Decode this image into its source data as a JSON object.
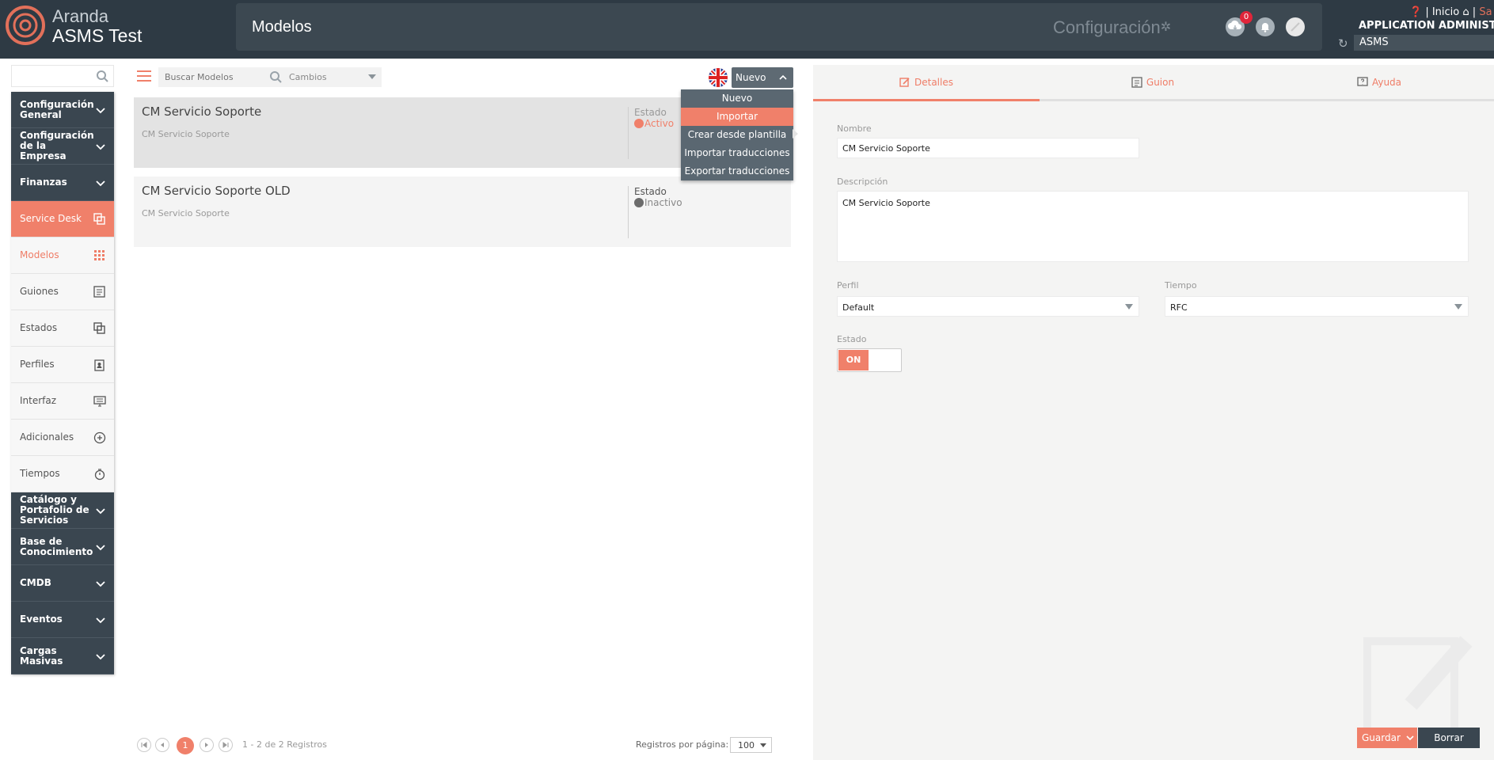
{
  "app": {
    "brand_line1": "Aranda",
    "brand_line2": "ASMS Test"
  },
  "header": {
    "page_title": "Modelos",
    "config_label": "Configuración",
    "notification_count": "0",
    "home_label": "Inicio",
    "exit_label": "Sa",
    "user_name": "APPLICATION ADMINISTRATO",
    "project": "ASMS"
  },
  "sidebar": {
    "search_placeholder": "",
    "items": [
      {
        "label": "Configuración General",
        "style": "dark",
        "icon": "chevron-down-icon"
      },
      {
        "label": "Configuración de la Empresa",
        "style": "dark",
        "icon": "chevron-down-icon"
      },
      {
        "label": "Finanzas",
        "style": "dark",
        "icon": "chevron-down-icon"
      },
      {
        "label": "Service Desk",
        "style": "orange",
        "icon": "copy-icon"
      },
      {
        "label": "Modelos",
        "style": "active",
        "icon": "grid-icon"
      },
      {
        "label": "Guiones",
        "style": "light",
        "icon": "document-icon"
      },
      {
        "label": "Estados",
        "style": "light",
        "icon": "copy-icon"
      },
      {
        "label": "Perfiles",
        "style": "light",
        "icon": "clipboard-user-icon"
      },
      {
        "label": "Interfaz",
        "style": "light",
        "icon": "monitor-icon"
      },
      {
        "label": "Adicionales",
        "style": "light",
        "icon": "plus-circle-icon"
      },
      {
        "label": "Tiempos",
        "style": "light",
        "icon": "stopwatch-icon"
      },
      {
        "label": "Catálogo y Portafolio de Servicios",
        "style": "dark",
        "icon": "chevron-down-icon"
      },
      {
        "label": "Base de Conocimiento",
        "style": "dark",
        "icon": "chevron-down-icon"
      },
      {
        "label": "CMDB",
        "style": "dark",
        "icon": "chevron-down-icon"
      },
      {
        "label": "Eventos",
        "style": "dark",
        "icon": "chevron-down-icon"
      },
      {
        "label": "Cargas Masivas",
        "style": "dark",
        "icon": "chevron-down-icon"
      }
    ]
  },
  "list": {
    "search_placeholder": "Buscar Modelos",
    "filter_value": "Cambios",
    "new_button": "Nuevo",
    "new_menu": [
      "Nuevo",
      "Importar",
      "Crear desde plantilla",
      "Importar traducciones",
      "Exportar traducciones"
    ],
    "state_label": "Estado",
    "rows": [
      {
        "name": "CM Servicio Soporte",
        "description": "CM Servicio Soporte",
        "status": "Activo",
        "status_color": "#f0806a"
      },
      {
        "name": "CM Servicio Soporte OLD",
        "description": "CM Servicio Soporte",
        "status": "Inactivo",
        "status_color": "#6b6b6b"
      }
    ],
    "pagination": {
      "current_page": "1",
      "info": "1 - 2 de 2 Registros",
      "per_page_label": "Registros por página:",
      "per_page": "100"
    }
  },
  "detail": {
    "tabs": [
      "Detalles",
      "Guion",
      "Ayuda"
    ],
    "name_label": "Nombre",
    "name_value": "CM Servicio Soporte",
    "description_label": "Descripción",
    "description_value": "CM Servicio Soporte",
    "profile_label": "Perfil",
    "profile_value": "Default",
    "time_label": "Tiempo",
    "time_value": "RFC",
    "state_label": "Estado",
    "state_toggle": "ON",
    "save_button": "Guardar",
    "delete_button": "Borrar"
  },
  "colors": {
    "accent": "#f0806a",
    "dark": "#3a4650",
    "header": "#2e3a44"
  }
}
